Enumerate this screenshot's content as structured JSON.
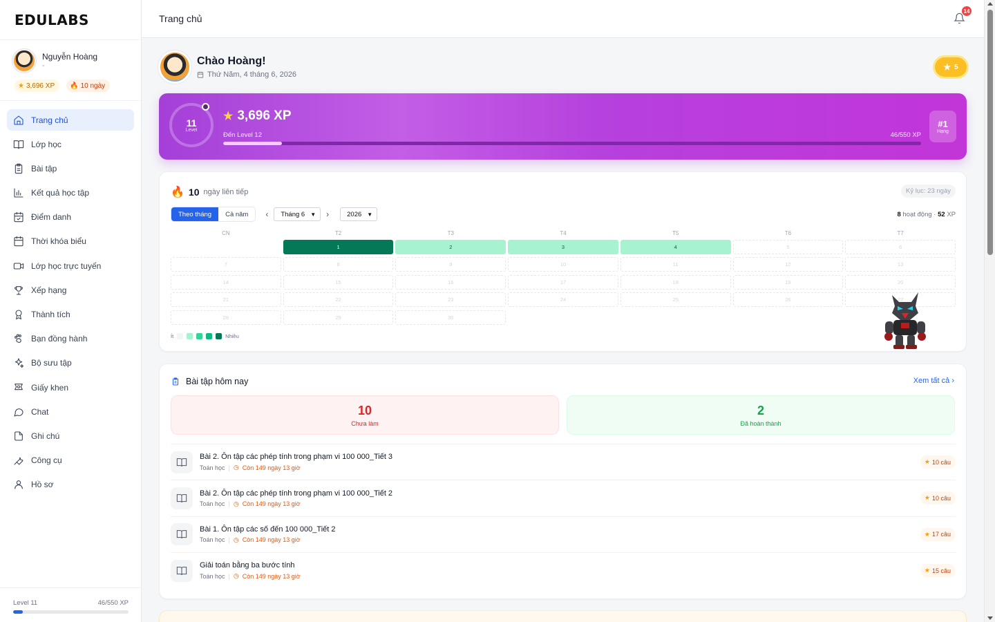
{
  "app": {
    "logo": "EDULABS"
  },
  "user": {
    "name": "Nguyễn Hoàng",
    "subtitle": "-",
    "xp": "3,696 XP",
    "streak": "10 ngày"
  },
  "sidebar": {
    "items": [
      {
        "label": "Trang chủ",
        "icon": "home-icon",
        "active": true
      },
      {
        "label": "Lớp học",
        "icon": "book-open-icon"
      },
      {
        "label": "Bài tập",
        "icon": "clipboard-icon"
      },
      {
        "label": "Kết quả học tập",
        "icon": "bar-chart-icon"
      },
      {
        "label": "Điểm danh",
        "icon": "calendar-check-icon"
      },
      {
        "label": "Thời khóa biểu",
        "icon": "calendar-icon"
      },
      {
        "label": "Lớp học trực tuyến",
        "icon": "video-icon"
      },
      {
        "label": "Xếp hạng",
        "icon": "trophy-icon"
      },
      {
        "label": "Thành tích",
        "icon": "medal-icon"
      },
      {
        "label": "Bạn đồng hành",
        "icon": "paw-icon"
      },
      {
        "label": "Bộ sưu tập",
        "icon": "sparkles-icon"
      },
      {
        "label": "Giấy khen",
        "icon": "award-icon"
      },
      {
        "label": "Chat",
        "icon": "chat-icon"
      },
      {
        "label": "Ghi chú",
        "icon": "file-icon"
      },
      {
        "label": "Công cụ",
        "icon": "wrench-icon"
      },
      {
        "label": "Hồ sơ",
        "icon": "user-icon"
      }
    ],
    "footer": {
      "level": "Level 11",
      "xp": "46/550 XP",
      "progress": 0.084
    }
  },
  "topbar": {
    "title": "Trang chủ",
    "notifications": "14"
  },
  "greeting": {
    "title": "Chào Hoàng!",
    "date": "Thứ Năm, 4 tháng 6, 2026",
    "stars": "5"
  },
  "xp_card": {
    "level": "11",
    "level_label": "Level",
    "xp": "3,696 XP",
    "next": "Đến Level 12",
    "count": "46/550 XP",
    "progress": 0.084,
    "rank": "#1",
    "rank_label": "Hạng"
  },
  "streak": {
    "days": "10",
    "label": "ngày liên tiếp",
    "record": "Kỷ lục: 23 ngày",
    "tab_month": "Theo tháng",
    "tab_year": "Cả năm",
    "month": "Tháng 6",
    "year": "2026",
    "summary_count": "8",
    "summary_label": "hoạt động ·",
    "summary_xp": "52",
    "summary_unit": "XP",
    "weekdays": [
      "CN",
      "T2",
      "T3",
      "T4",
      "T5",
      "T6",
      "T7"
    ],
    "legend_less": "Ít",
    "legend_more": "Nhiều",
    "calendar": [
      {
        "day": "",
        "level": -1
      },
      {
        "day": "1",
        "level": 4
      },
      {
        "day": "2",
        "level": 1
      },
      {
        "day": "3",
        "level": 1
      },
      {
        "day": "4",
        "level": 1
      },
      {
        "day": "5",
        "level": 0
      },
      {
        "day": "6",
        "level": 0
      },
      {
        "day": "7",
        "level": 0
      },
      {
        "day": "8",
        "level": 0
      },
      {
        "day": "9",
        "level": 0
      },
      {
        "day": "10",
        "level": 0
      },
      {
        "day": "11",
        "level": 0
      },
      {
        "day": "12",
        "level": 0
      },
      {
        "day": "13",
        "level": 0
      },
      {
        "day": "14",
        "level": 0
      },
      {
        "day": "15",
        "level": 0
      },
      {
        "day": "16",
        "level": 0
      },
      {
        "day": "17",
        "level": 0
      },
      {
        "day": "18",
        "level": 0
      },
      {
        "day": "19",
        "level": 0
      },
      {
        "day": "20",
        "level": 0
      },
      {
        "day": "21",
        "level": 0
      },
      {
        "day": "22",
        "level": 0
      },
      {
        "day": "23",
        "level": 0
      },
      {
        "day": "24",
        "level": 0
      },
      {
        "day": "25",
        "level": 0
      },
      {
        "day": "26",
        "level": 0
      },
      {
        "day": "27",
        "level": 0
      },
      {
        "day": "28",
        "level": 0
      },
      {
        "day": "29",
        "level": 0
      },
      {
        "day": "30",
        "level": 0
      }
    ]
  },
  "homework": {
    "title": "Bài tập hôm nay",
    "see_all": "Xem tất cả",
    "todo_count": "10",
    "todo_label": "Chưa làm",
    "done_count": "2",
    "done_label": "Đã hoàn thành",
    "items": [
      {
        "title": "Bài 2. Ôn tập các phép tính trong phạm vi 100 000_Tiết 3",
        "subject": "Toán học",
        "due": "Còn 149 ngày 13 giờ",
        "questions": "10 câu"
      },
      {
        "title": "Bài 2. Ôn tập các phép tính trong phạm vi 100 000_Tiết 2",
        "subject": "Toán học",
        "due": "Còn 149 ngày 13 giờ",
        "questions": "10 câu"
      },
      {
        "title": "Bài 1. Ôn tập các số đến 100 000_Tiết 2",
        "subject": "Toán học",
        "due": "Còn 149 ngày 13 giờ",
        "questions": "17 câu"
      },
      {
        "title": "Giải toán bằng ba bước tính",
        "subject": "Toán học",
        "due": "Còn 149 ngày 13 giờ",
        "questions": "15 câu"
      }
    ]
  },
  "colors": {
    "accent": "#2563eb",
    "xp_gradient_start": "#a43fd8",
    "streak_high": "#047857",
    "streak_low": "#a7f3d0"
  }
}
